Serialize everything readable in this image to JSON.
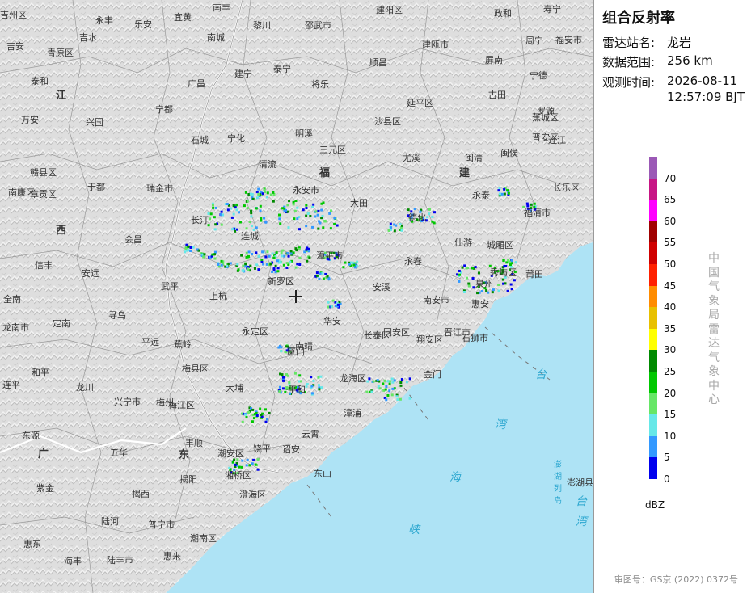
{
  "panel": {
    "title": "组合反射率",
    "station_label": "雷达站名:",
    "station_value": "龙岩",
    "range_label": "数据范围:",
    "range_value": "256 km",
    "time_label": "观测时间:",
    "time_date": "2026-08-11",
    "time_clock": "12:57:09 BJT",
    "unit": "dBZ",
    "vertical_text": [
      "中",
      "国",
      "气",
      "象",
      "局",
      "雷",
      "达",
      "气",
      "象",
      "中",
      "心"
    ],
    "review_no": "审图号：GS京 (2022) 0372号"
  },
  "scale": [
    {
      "value": "70",
      "color": "#9b59b6"
    },
    {
      "value": "65",
      "color": "#c71585"
    },
    {
      "value": "60",
      "color": "#ff00ff"
    },
    {
      "value": "55",
      "color": "#a00000"
    },
    {
      "value": "50",
      "color": "#d00000"
    },
    {
      "value": "45",
      "color": "#ff2000"
    },
    {
      "value": "40",
      "color": "#ff8c00"
    },
    {
      "value": "35",
      "color": "#e8c000"
    },
    {
      "value": "30",
      "color": "#ffff00"
    },
    {
      "value": "25",
      "color": "#008a00"
    },
    {
      "value": "20",
      "color": "#00c800"
    },
    {
      "value": "15",
      "color": "#66e666"
    },
    {
      "value": "10",
      "color": "#66e8e8"
    },
    {
      "value": "5",
      "color": "#3399ff"
    },
    {
      "value": "0",
      "color": "#0000ee"
    }
  ],
  "map": {
    "provinces": [
      "江",
      "福",
      "建",
      "西",
      "广",
      "东"
    ],
    "seas": [
      "台",
      "湾",
      "海",
      "峡",
      "台",
      "湾"
    ],
    "strait_label": [
      "澎",
      "湖",
      "列",
      "岛"
    ],
    "places": [
      "吉州区",
      "永丰",
      "乐安",
      "宜黄",
      "南丰",
      "黎川",
      "建阳区",
      "政和",
      "寿宁",
      "吉安",
      "吉水",
      "青原区",
      "南城",
      "邵武市",
      "建瓯市",
      "周宁",
      "福安市",
      "泰和",
      "广昌",
      "泰宁",
      "顺昌",
      "屏南",
      "宁德",
      "兴国",
      "宁都",
      "建宁",
      "将乐",
      "延平区",
      "古田",
      "万安",
      "蕉城区",
      "石城",
      "宁化",
      "明溪",
      "沙县区",
      "罗源",
      "闽清",
      "闽侯",
      "连江",
      "赣县区",
      "于都",
      "瑞金市",
      "清流",
      "三元区",
      "尤溪",
      "晋安区",
      "南康区",
      "章贡区",
      "长汀",
      "永安市",
      "大田",
      "永泰",
      "长乐区",
      "福清市",
      "会昌",
      "连城",
      "德化",
      "仙游",
      "城厢区",
      "秀屿区",
      "莆田",
      "信丰",
      "安远",
      "武平",
      "上杭",
      "漳平市",
      "永春",
      "南安市",
      "泉州",
      "惠安",
      "全南",
      "龙南市",
      "定南",
      "寻乌",
      "新罗区",
      "华安",
      "安溪",
      "同安区",
      "晋江市",
      "石狮市",
      "平远",
      "蕉岭",
      "永定区",
      "南靖",
      "长泰区",
      "翔安区",
      "金门",
      "和平",
      "龙川",
      "梅县区",
      "大埔",
      "平和",
      "龙海区",
      "漳浦",
      "连平",
      "兴宁市",
      "梅江区",
      "丰顺",
      "饶平",
      "诏安",
      "云霄",
      "东源",
      "五华",
      "揭西",
      "揭阳",
      "潮安区",
      "湘桥区",
      "澄海区",
      "东山",
      "紫金",
      "陆河",
      "普宁市",
      "潮南区",
      "惠东",
      "海丰",
      "陆丰市",
      "惠来",
      "澎湖县",
      "厦门",
      "梅州"
    ]
  }
}
